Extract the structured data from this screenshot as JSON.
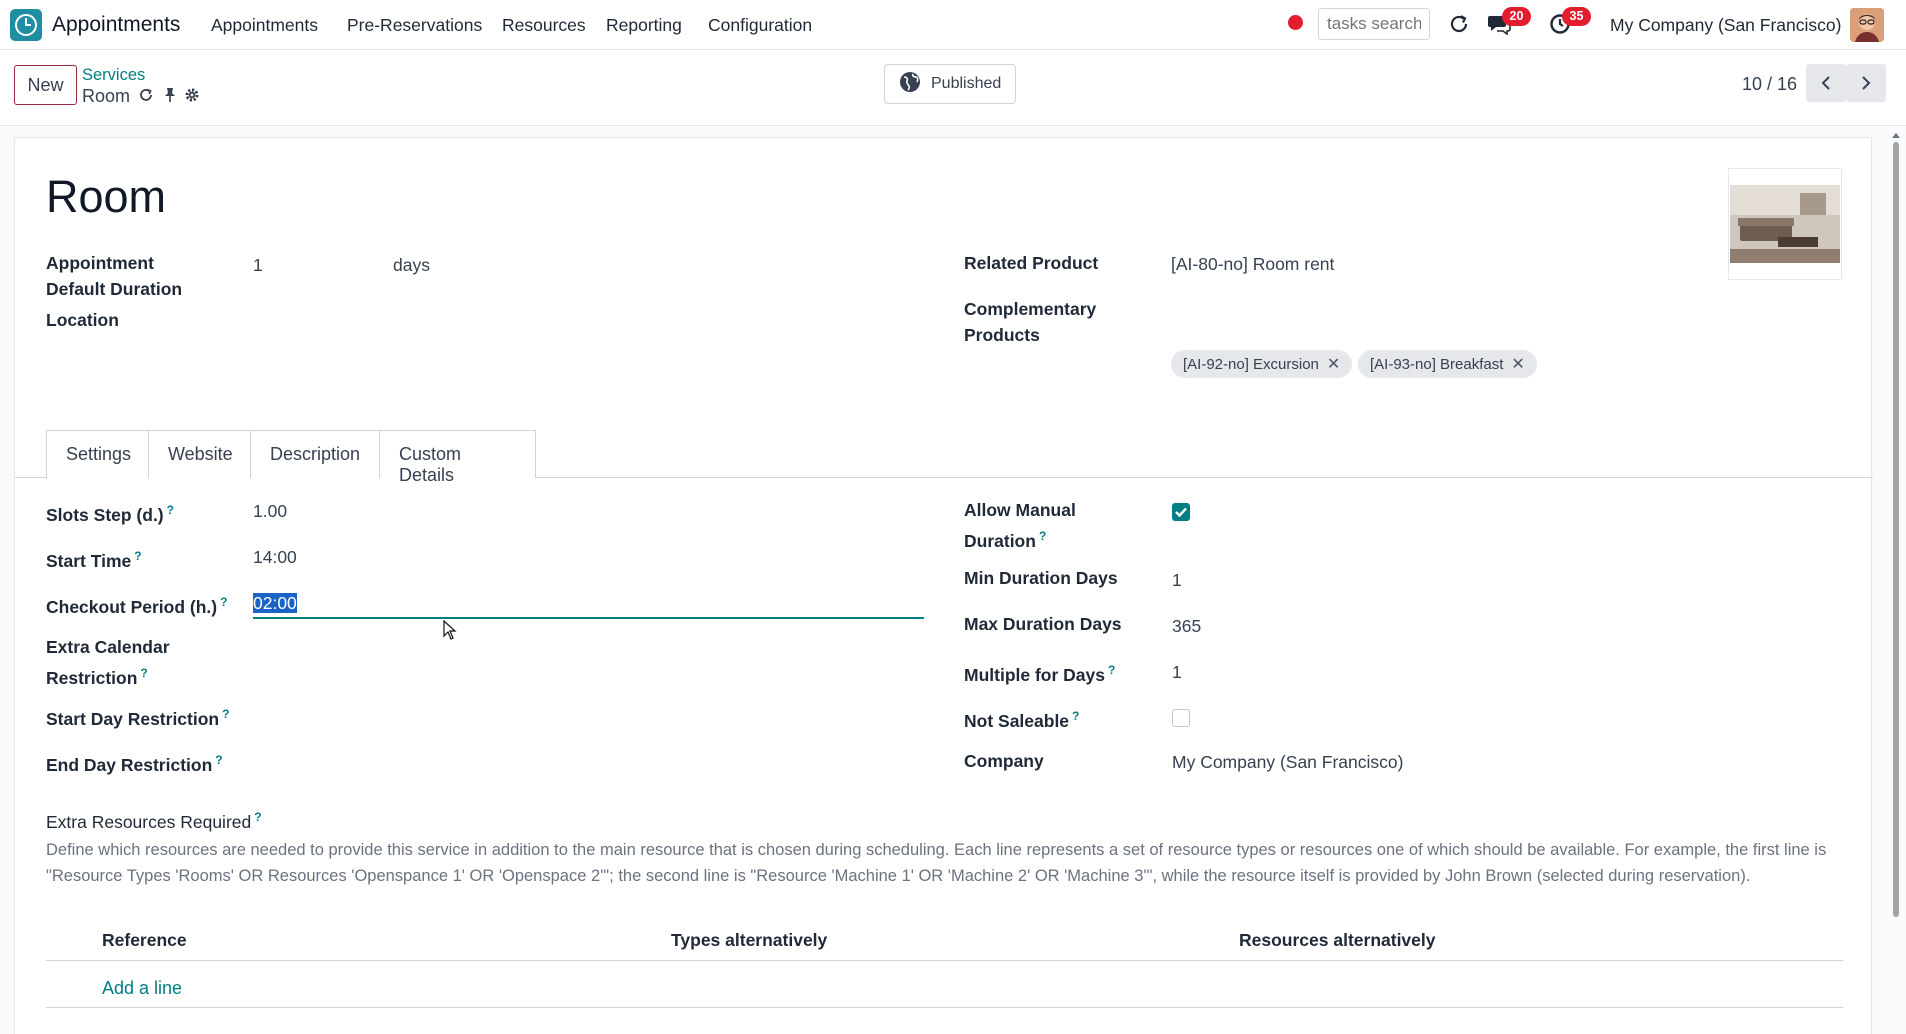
{
  "app": {
    "name": "Appointments",
    "menu": [
      "Appointments",
      "Pre-Reservations",
      "Resources",
      "Reporting",
      "Configuration"
    ],
    "search_placeholder": "tasks search",
    "messages_badge": "20",
    "activities_badge": "35",
    "company": "My Company (San Francisco)"
  },
  "control": {
    "new_label": "New",
    "breadcrumb_parent": "Services",
    "breadcrumb_current": "Room",
    "published_label": "Published",
    "pager": "10 / 16"
  },
  "record": {
    "title": "Room",
    "fields_top": {
      "duration_label": "Appointment Default Duration",
      "duration_value": "1",
      "duration_unit": "days",
      "location_label": "Location",
      "related_product_label": "Related Product",
      "related_product_value": "[AI-80-no] Room rent",
      "complementary_label": "Complementary Products",
      "complementary_tags": [
        "[AI-92-no] Excursion",
        "[AI-93-no] Breakfast"
      ]
    },
    "tabs": [
      "Settings",
      "Website",
      "Description",
      "Custom Details"
    ],
    "settings_left": {
      "slots_step_label": "Slots Step (d.)",
      "slots_step_value": "1.00",
      "start_time_label": "Start Time",
      "start_time_value": "14:00",
      "checkout_label": "Checkout Period (h.)",
      "checkout_value": "02:00",
      "extra_calendar_label": "Extra Calendar Restriction",
      "start_day_label": "Start Day Restriction",
      "end_day_label": "End Day Restriction"
    },
    "settings_right": {
      "allow_manual_label": "Allow Manual Duration",
      "allow_manual_checked": true,
      "min_duration_label": "Min Duration Days",
      "min_duration_value": "1",
      "max_duration_label": "Max Duration Days",
      "max_duration_value": "365",
      "multiple_label": "Multiple for Days",
      "multiple_value": "1",
      "not_saleable_label": "Not Saleable",
      "not_saleable_checked": false,
      "company_label": "Company",
      "company_value": "My Company (San Francisco)"
    },
    "extra_resources": {
      "title": "Extra Resources Required",
      "description": "Define which resources are needed to provide this service in addition to the main resource that is chosen during scheduling. Each line represents a set of resource types or resources one of which should be available. For example, the first line is \"Resource Types 'Rooms' OR Resources 'Openspance 1' OR 'Openspace 2'\"; the second line is \"Resource 'Machine 1' OR 'Machine 2' OR 'Machine 3'\", while the resource itself is provided by John Brown (selected during reservation).",
      "columns": [
        "Reference",
        "Types alternatively",
        "Resources alternatively"
      ],
      "add_line": "Add a line"
    }
  },
  "help_mark": "?",
  "colors": {
    "accent": "#017e84",
    "brand": "#9d2b3f",
    "badge": "#e11d2e"
  }
}
